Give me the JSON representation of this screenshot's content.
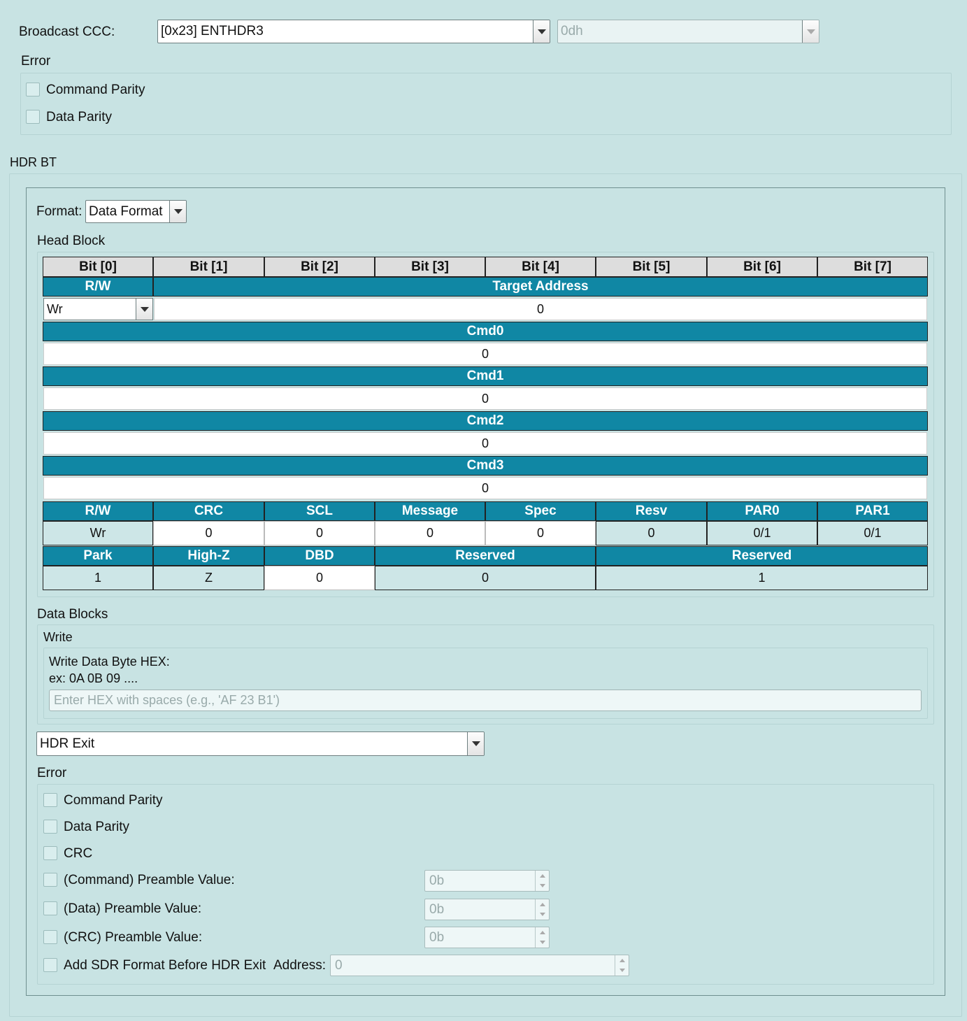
{
  "broadcast": {
    "label": "Broadcast CCC:",
    "ccc_value": "[0x23] ENTHDR3",
    "code_value": "0dh"
  },
  "error_top": {
    "title": "Error",
    "items": [
      "Command Parity",
      "Data Parity"
    ]
  },
  "hdr_bt": {
    "title": "HDR BT",
    "format_label": "Format:",
    "format_value": "Data Format",
    "head_block_title": "Head Block",
    "bit_headers": [
      "Bit [0]",
      "Bit [1]",
      "Bit [2]",
      "Bit [3]",
      "Bit [4]",
      "Bit [5]",
      "Bit [6]",
      "Bit [7]"
    ],
    "rw_label": "R/W",
    "target_address_label": "Target Address",
    "rw_select": "Wr",
    "target_address_value": "0",
    "cmds": [
      {
        "label": "Cmd0",
        "value": "0"
      },
      {
        "label": "Cmd1",
        "value": "0"
      },
      {
        "label": "Cmd2",
        "value": "0"
      },
      {
        "label": "Cmd3",
        "value": "0"
      }
    ],
    "row_a_headers": [
      "R/W",
      "CRC",
      "SCL",
      "Message",
      "Spec",
      "Resv",
      "PAR0",
      "PAR1"
    ],
    "row_a_values": [
      "Wr",
      "0",
      "0",
      "0",
      "0",
      "0",
      "0/1",
      "0/1"
    ],
    "row_b_headers": [
      "Park",
      "High-Z",
      "DBD",
      "Reserved",
      "Reserved"
    ],
    "row_b_values": [
      "1",
      "Z",
      "0",
      "0",
      "1"
    ],
    "data_blocks_title": "Data Blocks",
    "write_title": "Write",
    "write_hint_line1": "Write Data Byte HEX:",
    "write_hint_line2": "ex: 0A 0B 09 ....",
    "write_placeholder": "Enter HEX with spaces (e.g., 'AF 23 B1')",
    "exit_select": "HDR Exit",
    "error_title": "Error",
    "error_items": [
      "Command Parity",
      "Data Parity",
      "CRC"
    ],
    "preambles": [
      {
        "label": "(Command) Preamble Value:",
        "value": "0b"
      },
      {
        "label": "(Data) Preamble Value:",
        "value": "0b"
      },
      {
        "label": "(CRC) Preamble Value:",
        "value": "0b"
      }
    ],
    "sdr_label": "Add SDR Format Before HDR Exit",
    "address_label": "Address:",
    "address_value": "0"
  }
}
